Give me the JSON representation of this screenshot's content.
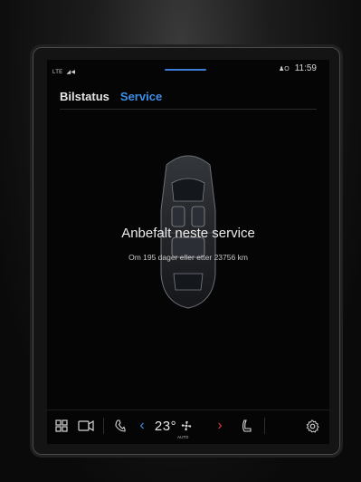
{
  "status_bar": {
    "network": "LTE",
    "time": "11:59"
  },
  "tabs": [
    {
      "label": "Bilstatus",
      "active": false
    },
    {
      "label": "Service",
      "active": true
    }
  ],
  "service": {
    "headline": "Anbefalt neste service",
    "detail": "Om 195 dager eller etter 23756 km"
  },
  "climate_bar": {
    "temperature": "23°",
    "mode": "AUTO",
    "icons": [
      "app-grid-icon",
      "camera-icon",
      "phone-icon",
      "temp-down-icon",
      "fan-icon",
      "temp-up-icon",
      "seat-heat-icon",
      "settings-icon"
    ]
  },
  "colors": {
    "accent": "#3d8fe8",
    "temp_up": "#d63a3a",
    "background": "#050506"
  }
}
